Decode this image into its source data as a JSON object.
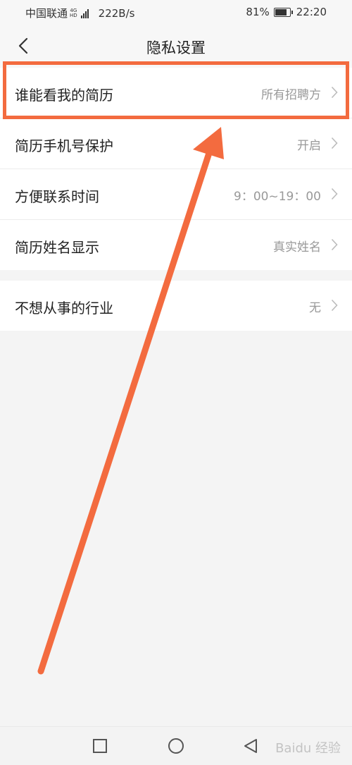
{
  "status_bar": {
    "carrier": "中国联通",
    "net_top": "4G",
    "net_bottom": "HD",
    "speed": "222B/s",
    "battery": "81%",
    "battery_level": 0.81,
    "time": "22:20"
  },
  "header": {
    "title": "隐私设置"
  },
  "privacy": {
    "group1": [
      {
        "label": "谁能看我的简历",
        "value": "所有招聘方"
      },
      {
        "label": "简历手机号保护",
        "value": "开启"
      },
      {
        "label": "方便联系时间",
        "value": "9：00~19：00"
      },
      {
        "label": "简历姓名显示",
        "value": "真实姓名"
      }
    ],
    "group2": [
      {
        "label": "不想从事的行业",
        "value": "无"
      }
    ]
  },
  "watermark": "Baidu 经验",
  "colors": {
    "accent": "#f36b3f",
    "value_text": "#999999",
    "background": "#f4f4f4"
  },
  "icons": {
    "back": "chevron-left-icon",
    "row": "chevron-right-icon",
    "nav_recent": "square-icon",
    "nav_home": "circle-icon",
    "nav_back": "triangle-left-icon"
  }
}
